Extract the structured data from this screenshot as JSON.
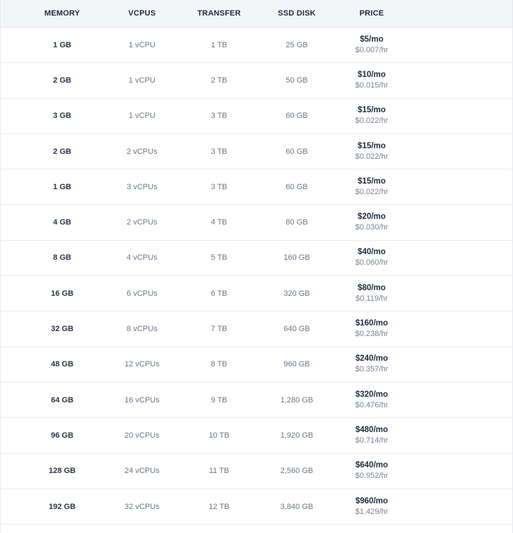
{
  "headers": {
    "memory": "MEMORY",
    "vcpus": "VCPUS",
    "transfer": "TRANSFER",
    "ssd": "SSD DISK",
    "price": "PRICE"
  },
  "rows": [
    {
      "memory": "1 GB",
      "vcpus": "1 vCPU",
      "transfer": "1 TB",
      "ssd": "25 GB",
      "price_mo": "$5/mo",
      "price_hr": "$0.007/hr"
    },
    {
      "memory": "2 GB",
      "vcpus": "1 vCPU",
      "transfer": "2 TB",
      "ssd": "50 GB",
      "price_mo": "$10/mo",
      "price_hr": "$0.015/hr"
    },
    {
      "memory": "3 GB",
      "vcpus": "1 vCPU",
      "transfer": "3 TB",
      "ssd": "60 GB",
      "price_mo": "$15/mo",
      "price_hr": "$0.022/hr"
    },
    {
      "memory": "2 GB",
      "vcpus": "2 vCPUs",
      "transfer": "3 TB",
      "ssd": "60 GB",
      "price_mo": "$15/mo",
      "price_hr": "$0.022/hr"
    },
    {
      "memory": "1 GB",
      "vcpus": "3 vCPUs",
      "transfer": "3 TB",
      "ssd": "60 GB",
      "price_mo": "$15/mo",
      "price_hr": "$0.022/hr"
    },
    {
      "memory": "4 GB",
      "vcpus": "2 vCPUs",
      "transfer": "4 TB",
      "ssd": "80 GB",
      "price_mo": "$20/mo",
      "price_hr": "$0.030/hr"
    },
    {
      "memory": "8 GB",
      "vcpus": "4 vCPUs",
      "transfer": "5 TB",
      "ssd": "160 GB",
      "price_mo": "$40/mo",
      "price_hr": "$0.060/hr"
    },
    {
      "memory": "16 GB",
      "vcpus": "6 vCPUs",
      "transfer": "6 TB",
      "ssd": "320 GB",
      "price_mo": "$80/mo",
      "price_hr": "$0.119/hr"
    },
    {
      "memory": "32 GB",
      "vcpus": "8 vCPUs",
      "transfer": "7 TB",
      "ssd": "640 GB",
      "price_mo": "$160/mo",
      "price_hr": "$0.238/hr"
    },
    {
      "memory": "48 GB",
      "vcpus": "12 vCPUs",
      "transfer": "8 TB",
      "ssd": "960 GB",
      "price_mo": "$240/mo",
      "price_hr": "$0.357/hr"
    },
    {
      "memory": "64 GB",
      "vcpus": "16 vCPUs",
      "transfer": "9 TB",
      "ssd": "1,280 GB",
      "price_mo": "$320/mo",
      "price_hr": "$0.476/hr"
    },
    {
      "memory": "96 GB",
      "vcpus": "20 vCPUs",
      "transfer": "10 TB",
      "ssd": "1,920 GB",
      "price_mo": "$480/mo",
      "price_hr": "$0.714/hr"
    },
    {
      "memory": "128 GB",
      "vcpus": "24 vCPUs",
      "transfer": "11 TB",
      "ssd": "2,560 GB",
      "price_mo": "$640/mo",
      "price_hr": "$0.952/hr"
    },
    {
      "memory": "192 GB",
      "vcpus": "32 vCPUs",
      "transfer": "12 TB",
      "ssd": "3,840 GB",
      "price_mo": "$960/mo",
      "price_hr": "$1.429/hr"
    }
  ]
}
